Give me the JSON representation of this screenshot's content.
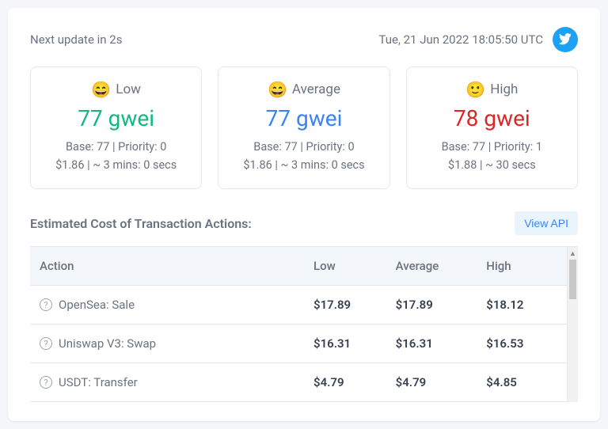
{
  "header": {
    "next_update": "Next update in 2s",
    "timestamp": "Tue, 21 Jun 2022 18:05:50 UTC"
  },
  "gas": {
    "low": {
      "label": "Low",
      "emoji": "😄",
      "value": "77 gwei",
      "base_priority": "Base: 77 | Priority: 0",
      "cost_time": "$1.86 | ~ 3 mins: 0 secs"
    },
    "avg": {
      "label": "Average",
      "emoji": "😄",
      "value": "77 gwei",
      "base_priority": "Base: 77 | Priority: 0",
      "cost_time": "$1.86 | ~ 3 mins: 0 secs"
    },
    "high": {
      "label": "High",
      "emoji": "🙂",
      "value": "78 gwei",
      "base_priority": "Base: 77 | Priority: 1",
      "cost_time": "$1.88 | ~ 30 secs"
    }
  },
  "actions_table": {
    "title": "Estimated Cost of Transaction Actions:",
    "view_api_label": "View API",
    "headers": {
      "action": "Action",
      "low": "Low",
      "avg": "Average",
      "high": "High"
    },
    "rows": [
      {
        "action": "OpenSea: Sale",
        "low": "$17.89",
        "avg": "$17.89",
        "high": "$18.12"
      },
      {
        "action": "Uniswap V3: Swap",
        "low": "$16.31",
        "avg": "$16.31",
        "high": "$16.53"
      },
      {
        "action": "USDT: Transfer",
        "low": "$4.79",
        "avg": "$4.79",
        "high": "$4.85"
      }
    ]
  }
}
